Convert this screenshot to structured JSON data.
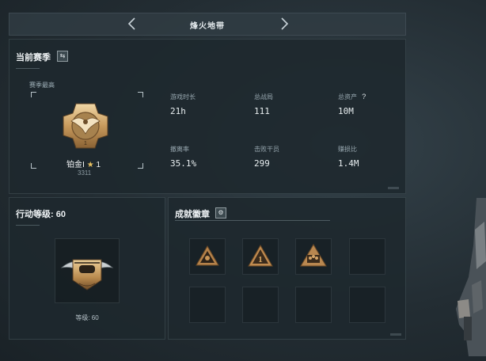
{
  "header": {
    "title": "烽火地带"
  },
  "season": {
    "title": "当前赛季",
    "peak_label": "赛季最高",
    "rank_name": "铂金Ⅰ",
    "rank_stars": "1",
    "rank_score": "3311",
    "stats": [
      {
        "label": "游戏时长",
        "value": "21h"
      },
      {
        "label": "总战局",
        "value": "111"
      },
      {
        "label": "总资产",
        "value": "10M"
      },
      {
        "label": "撤离率",
        "value": "35.1%"
      },
      {
        "label": "击败干员",
        "value": "299"
      },
      {
        "label": "赚损比",
        "value": "1.4M"
      }
    ],
    "help_glyph": "?"
  },
  "level": {
    "title": "行动等级: 60",
    "caption": "等级: 60"
  },
  "badges": {
    "title": "成就徽章",
    "slots": [
      "hazard-badge",
      "rank-one-badge",
      "squad-badge",
      "empty",
      "empty",
      "empty",
      "empty",
      "empty"
    ]
  },
  "colors": {
    "accent_gold": "#c8a060",
    "panel_bg": "#1e282e"
  }
}
